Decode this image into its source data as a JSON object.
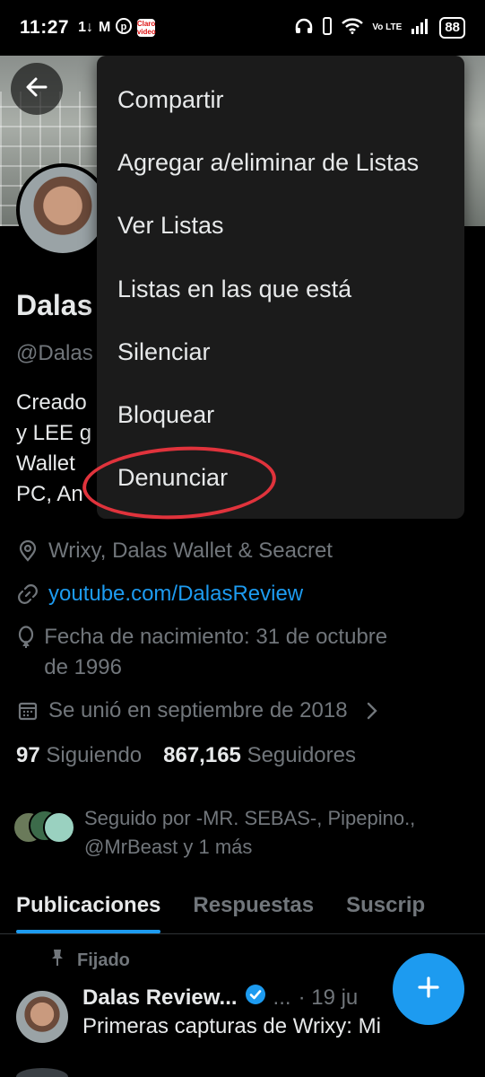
{
  "status_bar": {
    "time": "11:27",
    "left_icons": [
      "data-arrows-icon",
      "gmail-icon",
      "pinterest-icon",
      "claro-video-icon"
    ],
    "claro_label": "Claro video",
    "right_icons": [
      "headphones-icon",
      "vibrate-icon",
      "wifi-icon",
      "volte-icon",
      "signal-icon",
      "battery-icon"
    ],
    "volte_label": "Vo LTE",
    "battery": "88"
  },
  "menu": {
    "items": [
      "Compartir",
      "Agregar a/eliminar de Listas",
      "Ver Listas",
      "Listas en las que está",
      "Silenciar",
      "Bloquear",
      "Denunciar"
    ],
    "highlighted_item": "Denunciar",
    "highlight_color": "#e0333c"
  },
  "profile": {
    "name": "Dalas",
    "handle": "@Dalas",
    "bio_lines": [
      "Creado",
      "y LEE g",
      "Wallet",
      "PC, An"
    ],
    "location": "Wrixy, Dalas Wallet & Seacret",
    "link": "youtube.com/DalasReview",
    "birthday": "Fecha de nacimiento: 31 de octubre de 1996",
    "joined": "Se unió en septiembre de 2018",
    "following_count": "97",
    "following_label": "Siguiendo",
    "followers_count": "867,165",
    "followers_label": "Seguidores",
    "followed_by": "Seguido por -MR. SEBAS-, Pipepino., @MrBeast y 1 más"
  },
  "tabs": [
    "Publicaciones",
    "Respuestas",
    "Suscrip"
  ],
  "active_tab": "Publicaciones",
  "post": {
    "pinned_label": "Fijado",
    "author": "Dalas Review...",
    "more": "...",
    "date": "· 19 ju",
    "text": "Primeras capturas de Wrixy: Mi"
  },
  "colors": {
    "accent": "#1d9bf0",
    "background": "#000000",
    "menu_bg": "#1b1b1b",
    "muted_text": "#71767b"
  }
}
